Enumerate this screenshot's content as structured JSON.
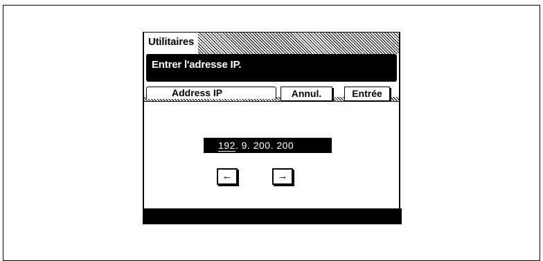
{
  "window": {
    "title": "Utilitaires"
  },
  "message": {
    "text": "Entrer l'adresse IP."
  },
  "tab": {
    "label": "Address IP"
  },
  "buttons": {
    "cancel": "Annul.",
    "enter": "Entrée"
  },
  "ip": {
    "octet1": "192",
    "rest": ". 9. 200. 200"
  },
  "arrows": {
    "left": "←",
    "right": "→"
  }
}
